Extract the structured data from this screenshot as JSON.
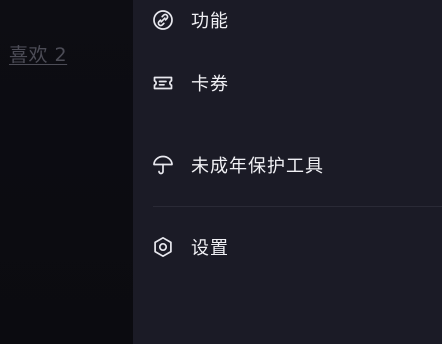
{
  "background": {
    "likes_text": "喜欢 2"
  },
  "drawer": {
    "items": [
      {
        "label": "功能",
        "icon": "link-icon"
      },
      {
        "label": "卡券",
        "icon": "ticket-icon"
      },
      {
        "label": "未成年保护工具",
        "icon": "umbrella-icon"
      },
      {
        "label": "设置",
        "icon": "gear-icon"
      }
    ]
  },
  "colors": {
    "drawer_bg": "#1b1b26",
    "backdrop_bg": "#0c0c12",
    "text": "#f0f0f4",
    "muted": "#4c4c56"
  }
}
